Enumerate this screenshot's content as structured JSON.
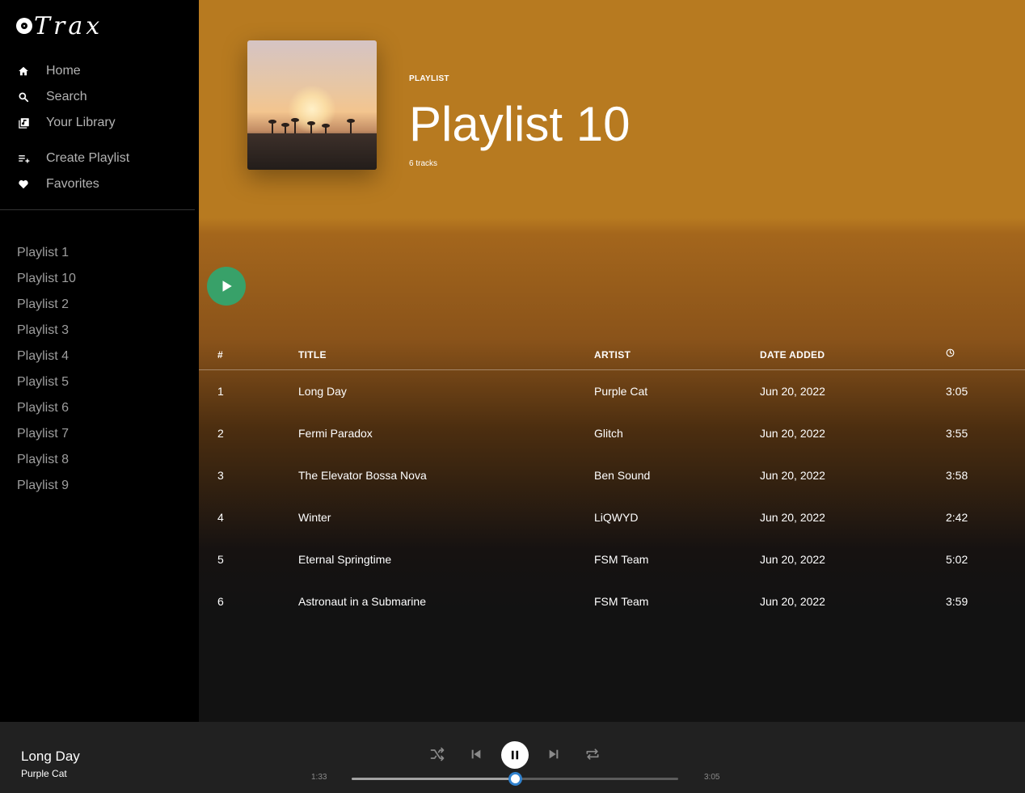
{
  "app": {
    "logo_text": "Trax"
  },
  "nav": {
    "primary": [
      {
        "label": "Home",
        "icon": "home-icon"
      },
      {
        "label": "Search",
        "icon": "search-icon"
      },
      {
        "label": "Your Library",
        "icon": "library-icon"
      }
    ],
    "secondary": [
      {
        "label": "Create Playlist",
        "icon": "playlist-add-icon"
      },
      {
        "label": "Favorites",
        "icon": "heart-icon"
      }
    ]
  },
  "sidebar_playlists": [
    "Playlist 1",
    "Playlist 10",
    "Playlist 2",
    "Playlist 3",
    "Playlist 4",
    "Playlist 5",
    "Playlist 6",
    "Playlist 7",
    "Playlist 8",
    "Playlist 9"
  ],
  "header": {
    "type_label": "PLAYLIST",
    "title": "Playlist 10",
    "count": "6 tracks",
    "bg_color": "#b77a20"
  },
  "play_button_color": "#38a169",
  "table": {
    "columns": {
      "num": "#",
      "title": "TITLE",
      "artist": "ARTIST",
      "date": "DATE ADDED",
      "duration_icon": "clock-icon"
    },
    "rows": [
      {
        "num": "1",
        "title": "Long Day",
        "artist": "Purple Cat",
        "date": "Jun 20, 2022",
        "duration": "3:05"
      },
      {
        "num": "2",
        "title": "Fermi Paradox",
        "artist": "Glitch",
        "date": "Jun 20, 2022",
        "duration": "3:55"
      },
      {
        "num": "3",
        "title": "The Elevator Bossa Nova",
        "artist": "Ben Sound",
        "date": "Jun 20, 2022",
        "duration": "3:58"
      },
      {
        "num": "4",
        "title": "Winter",
        "artist": "LiQWYD",
        "date": "Jun 20, 2022",
        "duration": "2:42"
      },
      {
        "num": "5",
        "title": "Eternal Springtime",
        "artist": "FSM Team",
        "date": "Jun 20, 2022",
        "duration": "5:02"
      },
      {
        "num": "6",
        "title": "Astronaut in a Submarine",
        "artist": "FSM Team",
        "date": "Jun 20, 2022",
        "duration": "3:59"
      }
    ]
  },
  "player": {
    "now_playing_title": "Long Day",
    "now_playing_artist": "Purple Cat",
    "elapsed": "1:33",
    "total": "3:05",
    "progress_fraction": 0.5,
    "accent_color": "#3182ce"
  }
}
